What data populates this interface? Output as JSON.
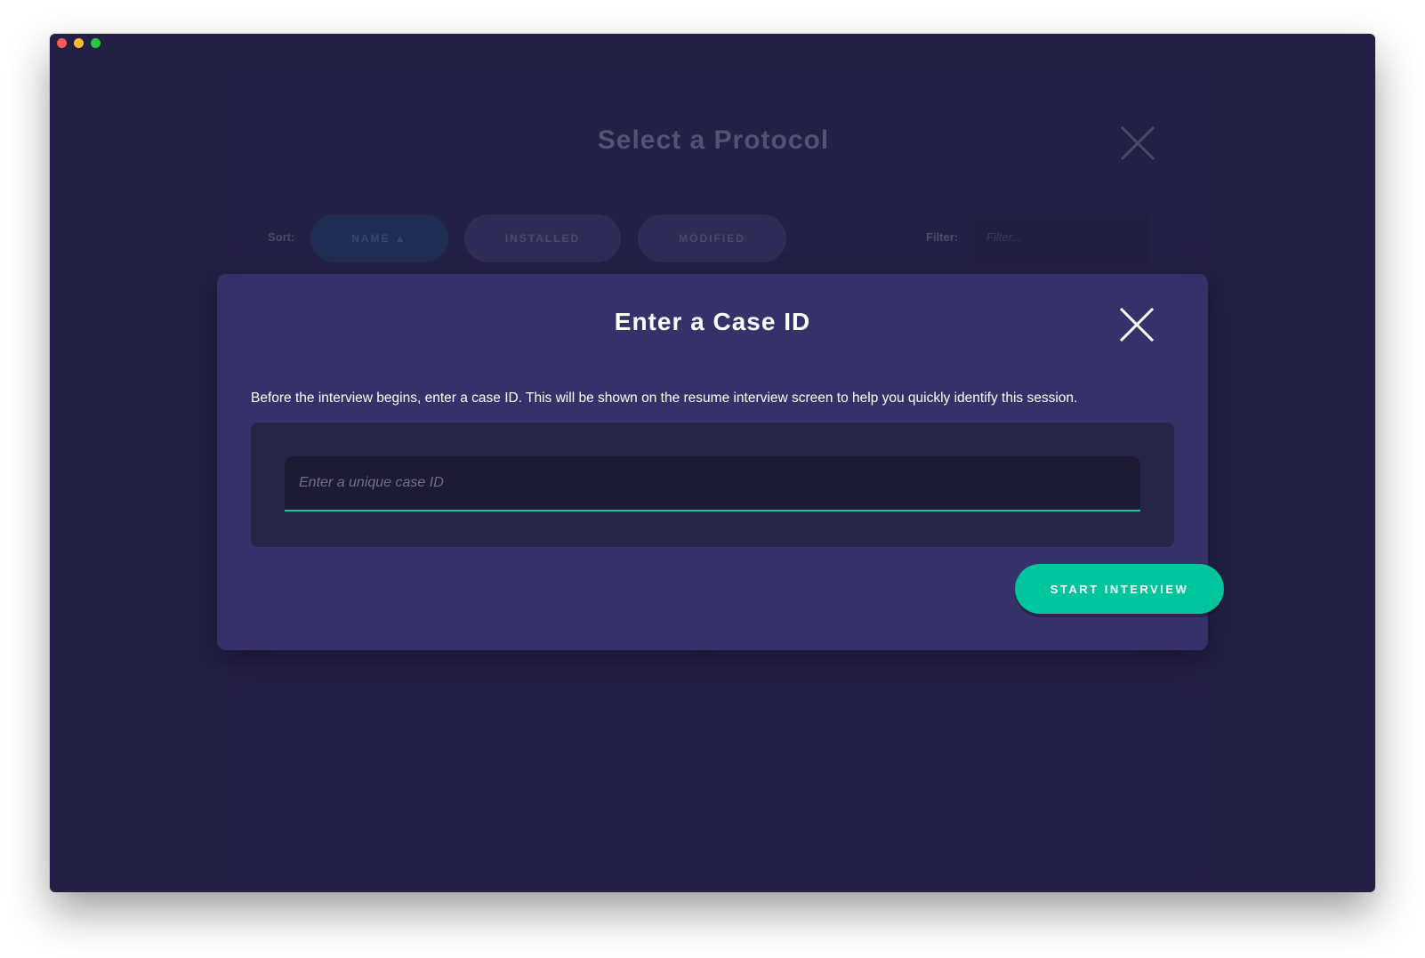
{
  "background": {
    "title": "Select a Protocol",
    "sort_label": "Sort:",
    "sort_buttons": [
      {
        "label": "NAME ▲"
      },
      {
        "label": "INSTALLED"
      },
      {
        "label": "MODIFIED"
      }
    ],
    "filter_label": "Filter:",
    "filter_placeholder": "Filter..."
  },
  "modal": {
    "title": "Enter a Case ID",
    "description": "Before the interview begins, enter a case ID. This will be shown on the resume interview screen to help you quickly identify this session.",
    "input": {
      "placeholder": "Enter a unique case ID",
      "value": ""
    },
    "start_button_label": "START INTERVIEW"
  },
  "colors": {
    "window_bg": "#231f45",
    "modal_bg": "#363269",
    "input_well": "#282449",
    "input_bg": "#1d1a33",
    "accent": "#00c49b"
  },
  "icons": {
    "close": "close-icon"
  }
}
